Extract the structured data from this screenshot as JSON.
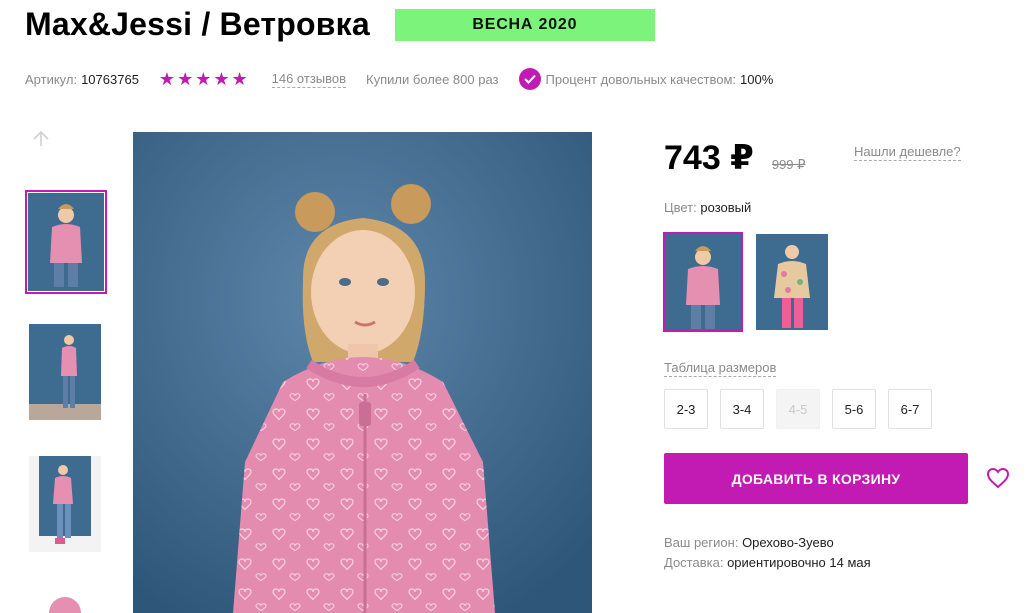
{
  "product": {
    "title": "Max&Jessi / Ветровка",
    "badge": "ВЕСНА 2020",
    "article_label": "Артикул:",
    "article_value": "10763765",
    "rating_stars": 5,
    "reviews_text": "146 отзывов",
    "bought_text": "Купили более 800 раз",
    "quality_label": "Процент довольных качеством:",
    "quality_value": "100%"
  },
  "pricing": {
    "price": "743 ₽",
    "old_price": "999 ₽",
    "cheaper_link": "Нашли дешевле?"
  },
  "color": {
    "label": "Цвет:",
    "value": "розовый"
  },
  "sizes": {
    "table_link": "Таблица размеров",
    "options": [
      {
        "label": "2-3",
        "available": true
      },
      {
        "label": "3-4",
        "available": true
      },
      {
        "label": "4-5",
        "available": false
      },
      {
        "label": "5-6",
        "available": true
      },
      {
        "label": "6-7",
        "available": true
      }
    ]
  },
  "cart": {
    "button_label": "ДОБАВИТЬ В КОРЗИНУ"
  },
  "delivery": {
    "region_label": "Ваш регион:",
    "region_value": "Орехово-Зуево",
    "delivery_label": "Доставка:",
    "delivery_value": "ориентировочно 14 мая"
  },
  "icons": {
    "star": "star-icon",
    "check": "check-icon",
    "arrow_up": "arrow-up-icon",
    "heart": "heart-icon"
  },
  "colors": {
    "accent": "#c21bb3",
    "badge_bg": "#7cf47c",
    "muted_text": "#8a8a8a"
  }
}
